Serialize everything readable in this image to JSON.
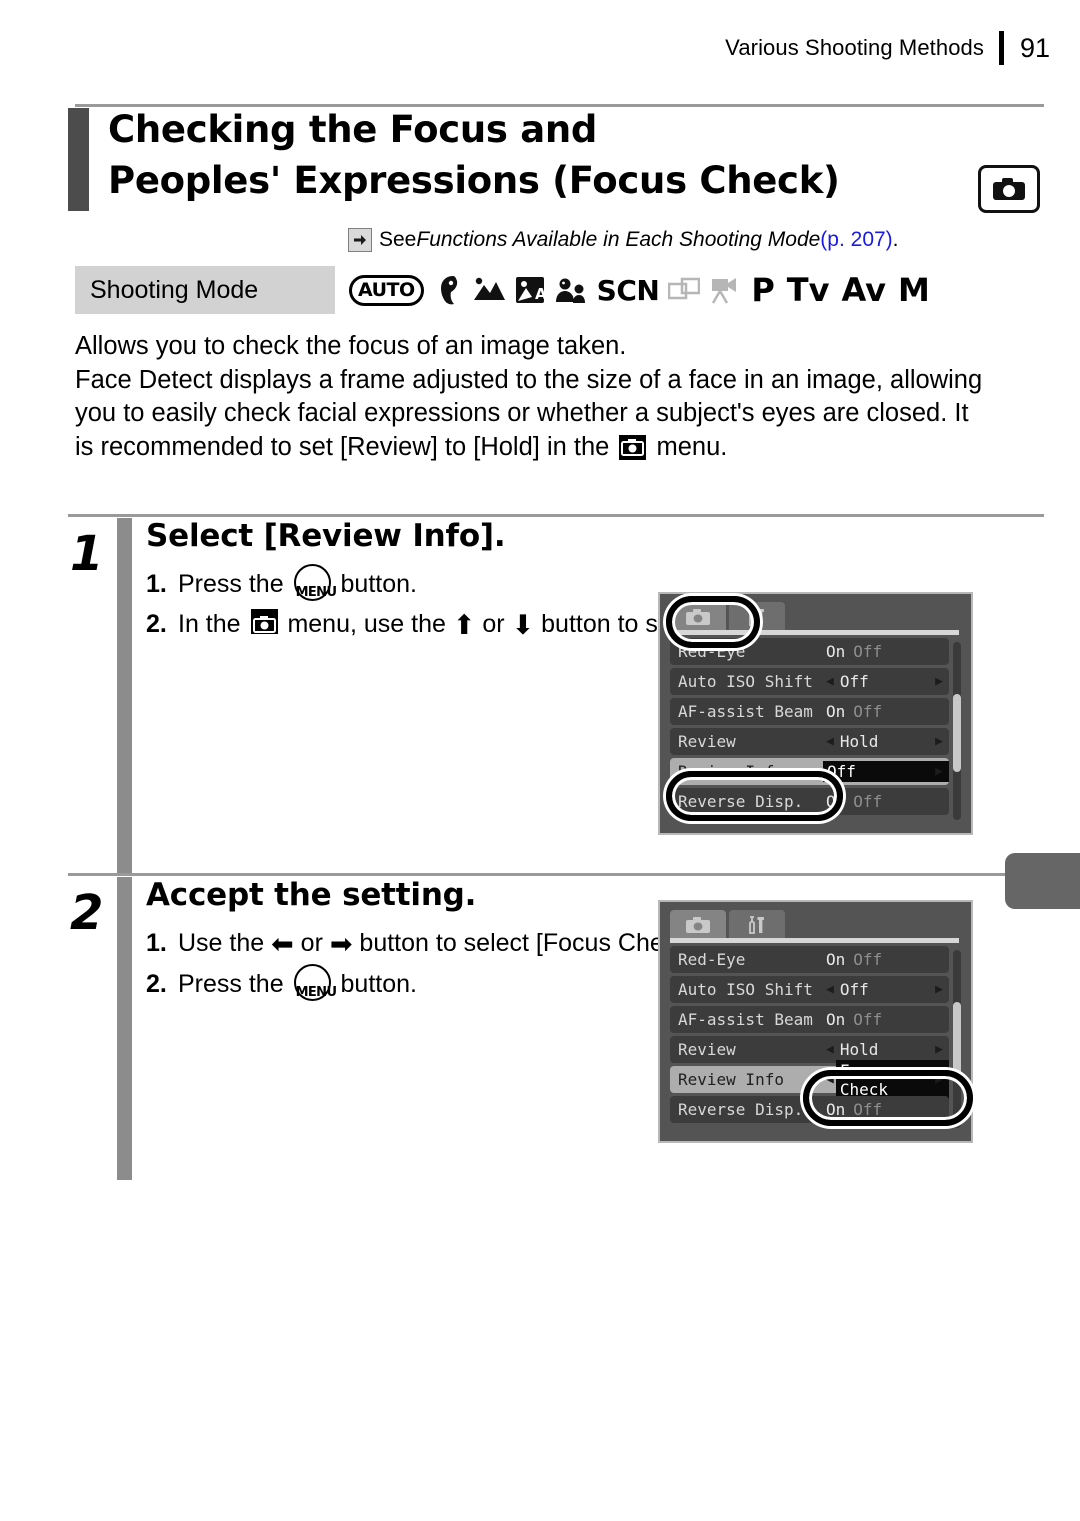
{
  "header": {
    "title": "Various Shooting Methods",
    "page_number": "91"
  },
  "title": {
    "line1": "Checking the Focus and",
    "line2": "Peoples' Expressions (Focus Check)",
    "badge_icon": "camera-icon"
  },
  "see_also": {
    "arrow_icon": "right-arrow-icon",
    "prefix": "See ",
    "italic": "Functions Available in Each Shooting Mode",
    "page_ref": " (p. 207)",
    "suffix": ".",
    "link_color": "#1a1ae6"
  },
  "shooting_mode": {
    "label": "Shooting Mode",
    "icons": [
      {
        "name": "auto-mode-icon",
        "text": "AUTO",
        "dim": false
      },
      {
        "name": "portrait-mode-icon",
        "text": "",
        "dim": false
      },
      {
        "name": "landscape-mode-icon",
        "text": "",
        "dim": false
      },
      {
        "name": "night-snapshot-mode-icon",
        "text": "",
        "dim": false
      },
      {
        "name": "kids-and-pets-mode-icon",
        "text": "",
        "dim": false
      },
      {
        "name": "scn-mode-icon",
        "text": "SCN",
        "dim": false
      },
      {
        "name": "stitch-assist-mode-icon",
        "text": "",
        "dim": true
      },
      {
        "name": "movie-mode-icon",
        "text": "",
        "dim": true
      },
      {
        "name": "program-mode-icon",
        "text": "P",
        "dim": false
      },
      {
        "name": "tv-mode-icon",
        "text": "Tv",
        "dim": false
      },
      {
        "name": "av-mode-icon",
        "text": "Av",
        "dim": false
      },
      {
        "name": "manual-mode-icon",
        "text": "M",
        "dim": false
      }
    ]
  },
  "intro": {
    "line1": "Allows you to check the focus of an image taken.",
    "para2_a": "Face Detect displays a frame adjusted to the size of a face in an image, allowing you to easily check facial expressions or whether a subject's eyes are closed. It is recommended to set [Review] to [Hold] in the ",
    "para2_b": " menu."
  },
  "steps": [
    {
      "number": "1",
      "heading": "Select [Review Info].",
      "substeps": [
        {
          "n": "1.",
          "a": "Press the ",
          "menu_btn": "MENU",
          "b": " button."
        },
        {
          "n": "2.",
          "a": "In the ",
          "b": " menu, use the ",
          "up": "⬆",
          "or": " or ",
          "down": "⬇",
          "c": " button to select [Review Info]."
        }
      ]
    },
    {
      "number": "2",
      "heading": "Accept the setting.",
      "substeps": [
        {
          "n": "1.",
          "a": "Use the ",
          "left": "⬅",
          "or": " or ",
          "right": "➡",
          "b": " button to select [Focus Check]."
        },
        {
          "n": "2.",
          "a": "Press the ",
          "menu_btn": "MENU",
          "b": " button."
        }
      ]
    }
  ],
  "lcd_screens": [
    {
      "name": "review-info-off-screen",
      "tabs": [
        {
          "icon": "camera-tab-icon",
          "active": true
        },
        {
          "icon": "tools-tab-icon",
          "active": false
        }
      ],
      "rows": [
        {
          "label": "Red-Eye",
          "type": "onoff",
          "on": "On",
          "off": "Off",
          "selected_value": "On",
          "highlighted": false
        },
        {
          "label": "Auto ISO Shift",
          "type": "value",
          "value": "Off",
          "carets": true,
          "highlighted": false,
          "box": false
        },
        {
          "label": "AF-assist Beam",
          "type": "onoff",
          "on": "On",
          "off": "Off",
          "selected_value": "On",
          "highlighted": false
        },
        {
          "label": "Review",
          "type": "value",
          "value": "Hold",
          "carets": true,
          "highlighted": false,
          "box": false
        },
        {
          "label": "Review Info",
          "type": "value",
          "value": "Off",
          "carets": true,
          "highlighted": true,
          "box": true
        },
        {
          "label": "Reverse Disp.",
          "type": "onoff",
          "on": "On",
          "off": "Off",
          "selected_value": "On",
          "highlighted": false
        }
      ],
      "callouts": [
        "camera-tab-callout",
        "review-info-row-callout"
      ]
    },
    {
      "name": "review-info-focus-check-screen",
      "tabs": [
        {
          "icon": "camera-tab-icon",
          "active": true
        },
        {
          "icon": "tools-tab-icon",
          "active": false
        }
      ],
      "rows": [
        {
          "label": "Red-Eye",
          "type": "onoff",
          "on": "On",
          "off": "Off",
          "selected_value": "On",
          "highlighted": false
        },
        {
          "label": "Auto ISO Shift",
          "type": "value",
          "value": "Off",
          "carets": true,
          "highlighted": false,
          "box": false
        },
        {
          "label": "AF-assist Beam",
          "type": "onoff",
          "on": "On",
          "off": "Off",
          "selected_value": "On",
          "highlighted": false
        },
        {
          "label": "Review",
          "type": "value",
          "value": "Hold",
          "carets": true,
          "highlighted": false,
          "box": false
        },
        {
          "label": "Review Info",
          "type": "value",
          "value": "Focus Check",
          "carets": true,
          "highlighted": true,
          "box": true
        },
        {
          "label": "Reverse Disp.",
          "type": "onoff",
          "on": "On",
          "off": "Off",
          "selected_value": "On",
          "highlighted": false
        }
      ],
      "callouts": [
        "focus-check-value-callout"
      ]
    }
  ]
}
